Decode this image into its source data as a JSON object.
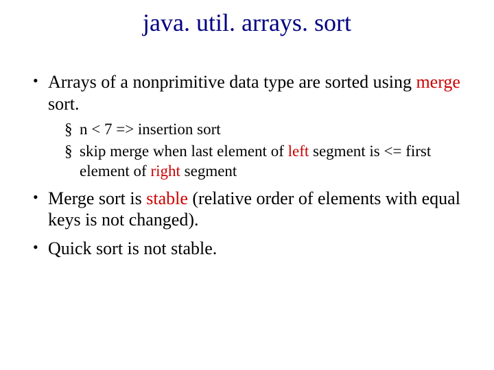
{
  "title": "java. util. arrays. sort",
  "bullets": {
    "b1_pre": "Arrays of a nonprimitive data type are sorted using ",
    "b1_accent": "merge",
    "b1_post": " sort.",
    "s1": "n < 7 => insertion sort",
    "s2_a": "skip merge when last element of ",
    "s2_b": "left",
    "s2_c": " segment is <= first element of ",
    "s2_d": "right",
    "s2_e": " segment",
    "b2_a": "Merge sort is ",
    "b2_b": "stable",
    "b2_c": " (relative order of elements with equal keys is not changed).",
    "b3": "Quick sort is not stable."
  }
}
